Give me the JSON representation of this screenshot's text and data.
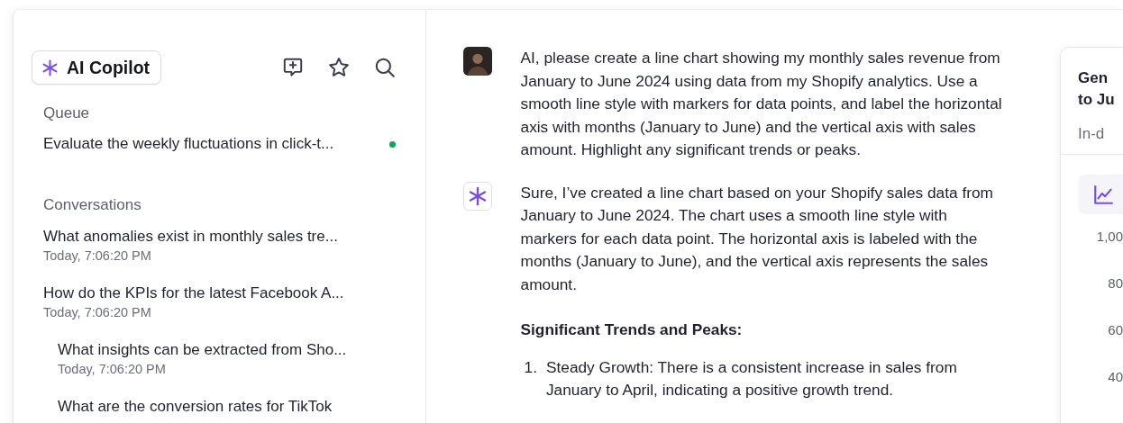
{
  "sidebar": {
    "brand": {
      "label": "AI Copilot"
    },
    "actions": [
      {
        "kind": "new-chat"
      },
      {
        "kind": "favorite"
      },
      {
        "kind": "search"
      }
    ],
    "queue": {
      "heading": "Queue",
      "items": [
        {
          "title": "Evaluate the weekly fluctuations in click-t...",
          "active": true
        }
      ]
    },
    "conversations": {
      "heading": "Conversations",
      "items": [
        {
          "title": "What anomalies exist in monthly sales tre...",
          "time": "Today, 7:06:20 PM"
        },
        {
          "title": "How do the KPIs for the latest Facebook A...",
          "time": "Today, 7:06:20 PM",
          "children": [
            {
              "title": "What insights can be extracted from Sho...",
              "time": "Today, 7:06:20 PM"
            },
            {
              "title": "What are the conversion rates for TikTok"
            }
          ]
        }
      ]
    }
  },
  "messages": [
    {
      "kind": "user",
      "blocks": [
        {
          "kind": "paragraph",
          "text": "AI, please create a line chart showing my monthly sales revenue from January to June 2024 using data from my Shopify analytics. Use a smooth line style with markers for data points, and label the horizontal axis with months (January to June) and the vertical axis with sales amount. Highlight any significant trends or peaks."
        }
      ]
    },
    {
      "kind": "assistant",
      "blocks": [
        {
          "kind": "paragraph",
          "text": "Sure, I’ve created a line chart based on your Shopify sales data from January to June 2024. The chart uses a smooth line style with markers for each data point. The horizontal axis is labeled with the months (January to June), and the vertical axis represents the sales amount."
        },
        {
          "kind": "heading",
          "text": "Significant Trends and Peaks:"
        },
        {
          "kind": "list-item",
          "marker": "1.",
          "text": "Steady Growth: There is a consistent increase in sales from January to April, indicating a positive growth trend."
        }
      ]
    }
  ],
  "panel": {
    "title_lines": [
      "Gen",
      "to Ju"
    ],
    "subtitle": "In-d",
    "y_labels": [
      "1,00",
      "80",
      "60",
      "40"
    ]
  }
}
